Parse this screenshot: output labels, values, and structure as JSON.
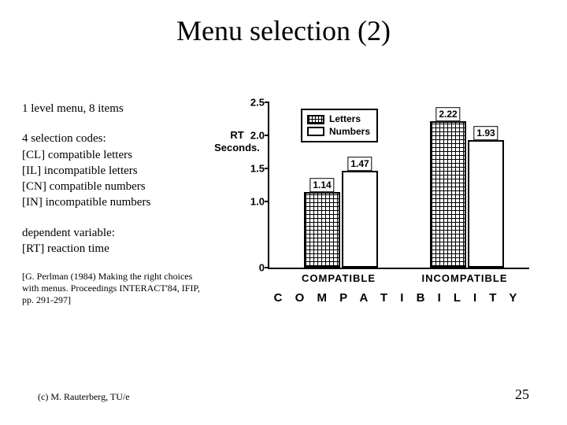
{
  "title": "Menu selection (2)",
  "left": {
    "line1": "1 level menu, 8 items",
    "codes_header": "4 selection codes:",
    "code_cl": "[CL] compatible letters",
    "code_il": "[IL] incompatible letters",
    "code_cn": "[CN] compatible numbers",
    "code_in": "[IN] incompatible numbers",
    "dv_header": "dependent variable:",
    "dv_line": "[RT] reaction time",
    "citation": "[G. Perlman (1984) Making the right choices with menus. Proceedings INTERACT'84, IFIP, pp. 291-297]"
  },
  "footer": {
    "left": "(c) M. Rauterberg, TU/e",
    "right": "25"
  },
  "chart_data": {
    "type": "bar",
    "title": "",
    "ylabel": "RT Seconds.",
    "xlabel": "C O M P A T I B I L I T Y",
    "categories": [
      "COMPATIBLE",
      "INCOMPATIBLE"
    ],
    "series": [
      {
        "name": "Letters",
        "values": [
          1.14,
          2.22
        ]
      },
      {
        "name": "Numbers",
        "values": [
          1.47,
          1.93
        ]
      }
    ],
    "ylim": [
      0,
      2.5
    ],
    "yticks": [
      0,
      1.0,
      1.5,
      2.0,
      2.5
    ],
    "legend_position": "top-inside"
  },
  "chart_labels": {
    "tick_25": "2.5",
    "tick_20": "2.0",
    "tick_15": "1.5",
    "tick_10": "1.0",
    "tick_0": "0",
    "ylabel_l1": "RT",
    "ylabel_l2": "Seconds.",
    "cat0": "COMPATIBLE",
    "cat1": "INCOMPATIBLE",
    "xaxis": "C O M P A T I B I L I T Y",
    "legend_letters": "Letters",
    "legend_numbers": "Numbers",
    "v_cl": "1.14",
    "v_cn": "1.47",
    "v_il": "2.22",
    "v_in": "1.93"
  }
}
